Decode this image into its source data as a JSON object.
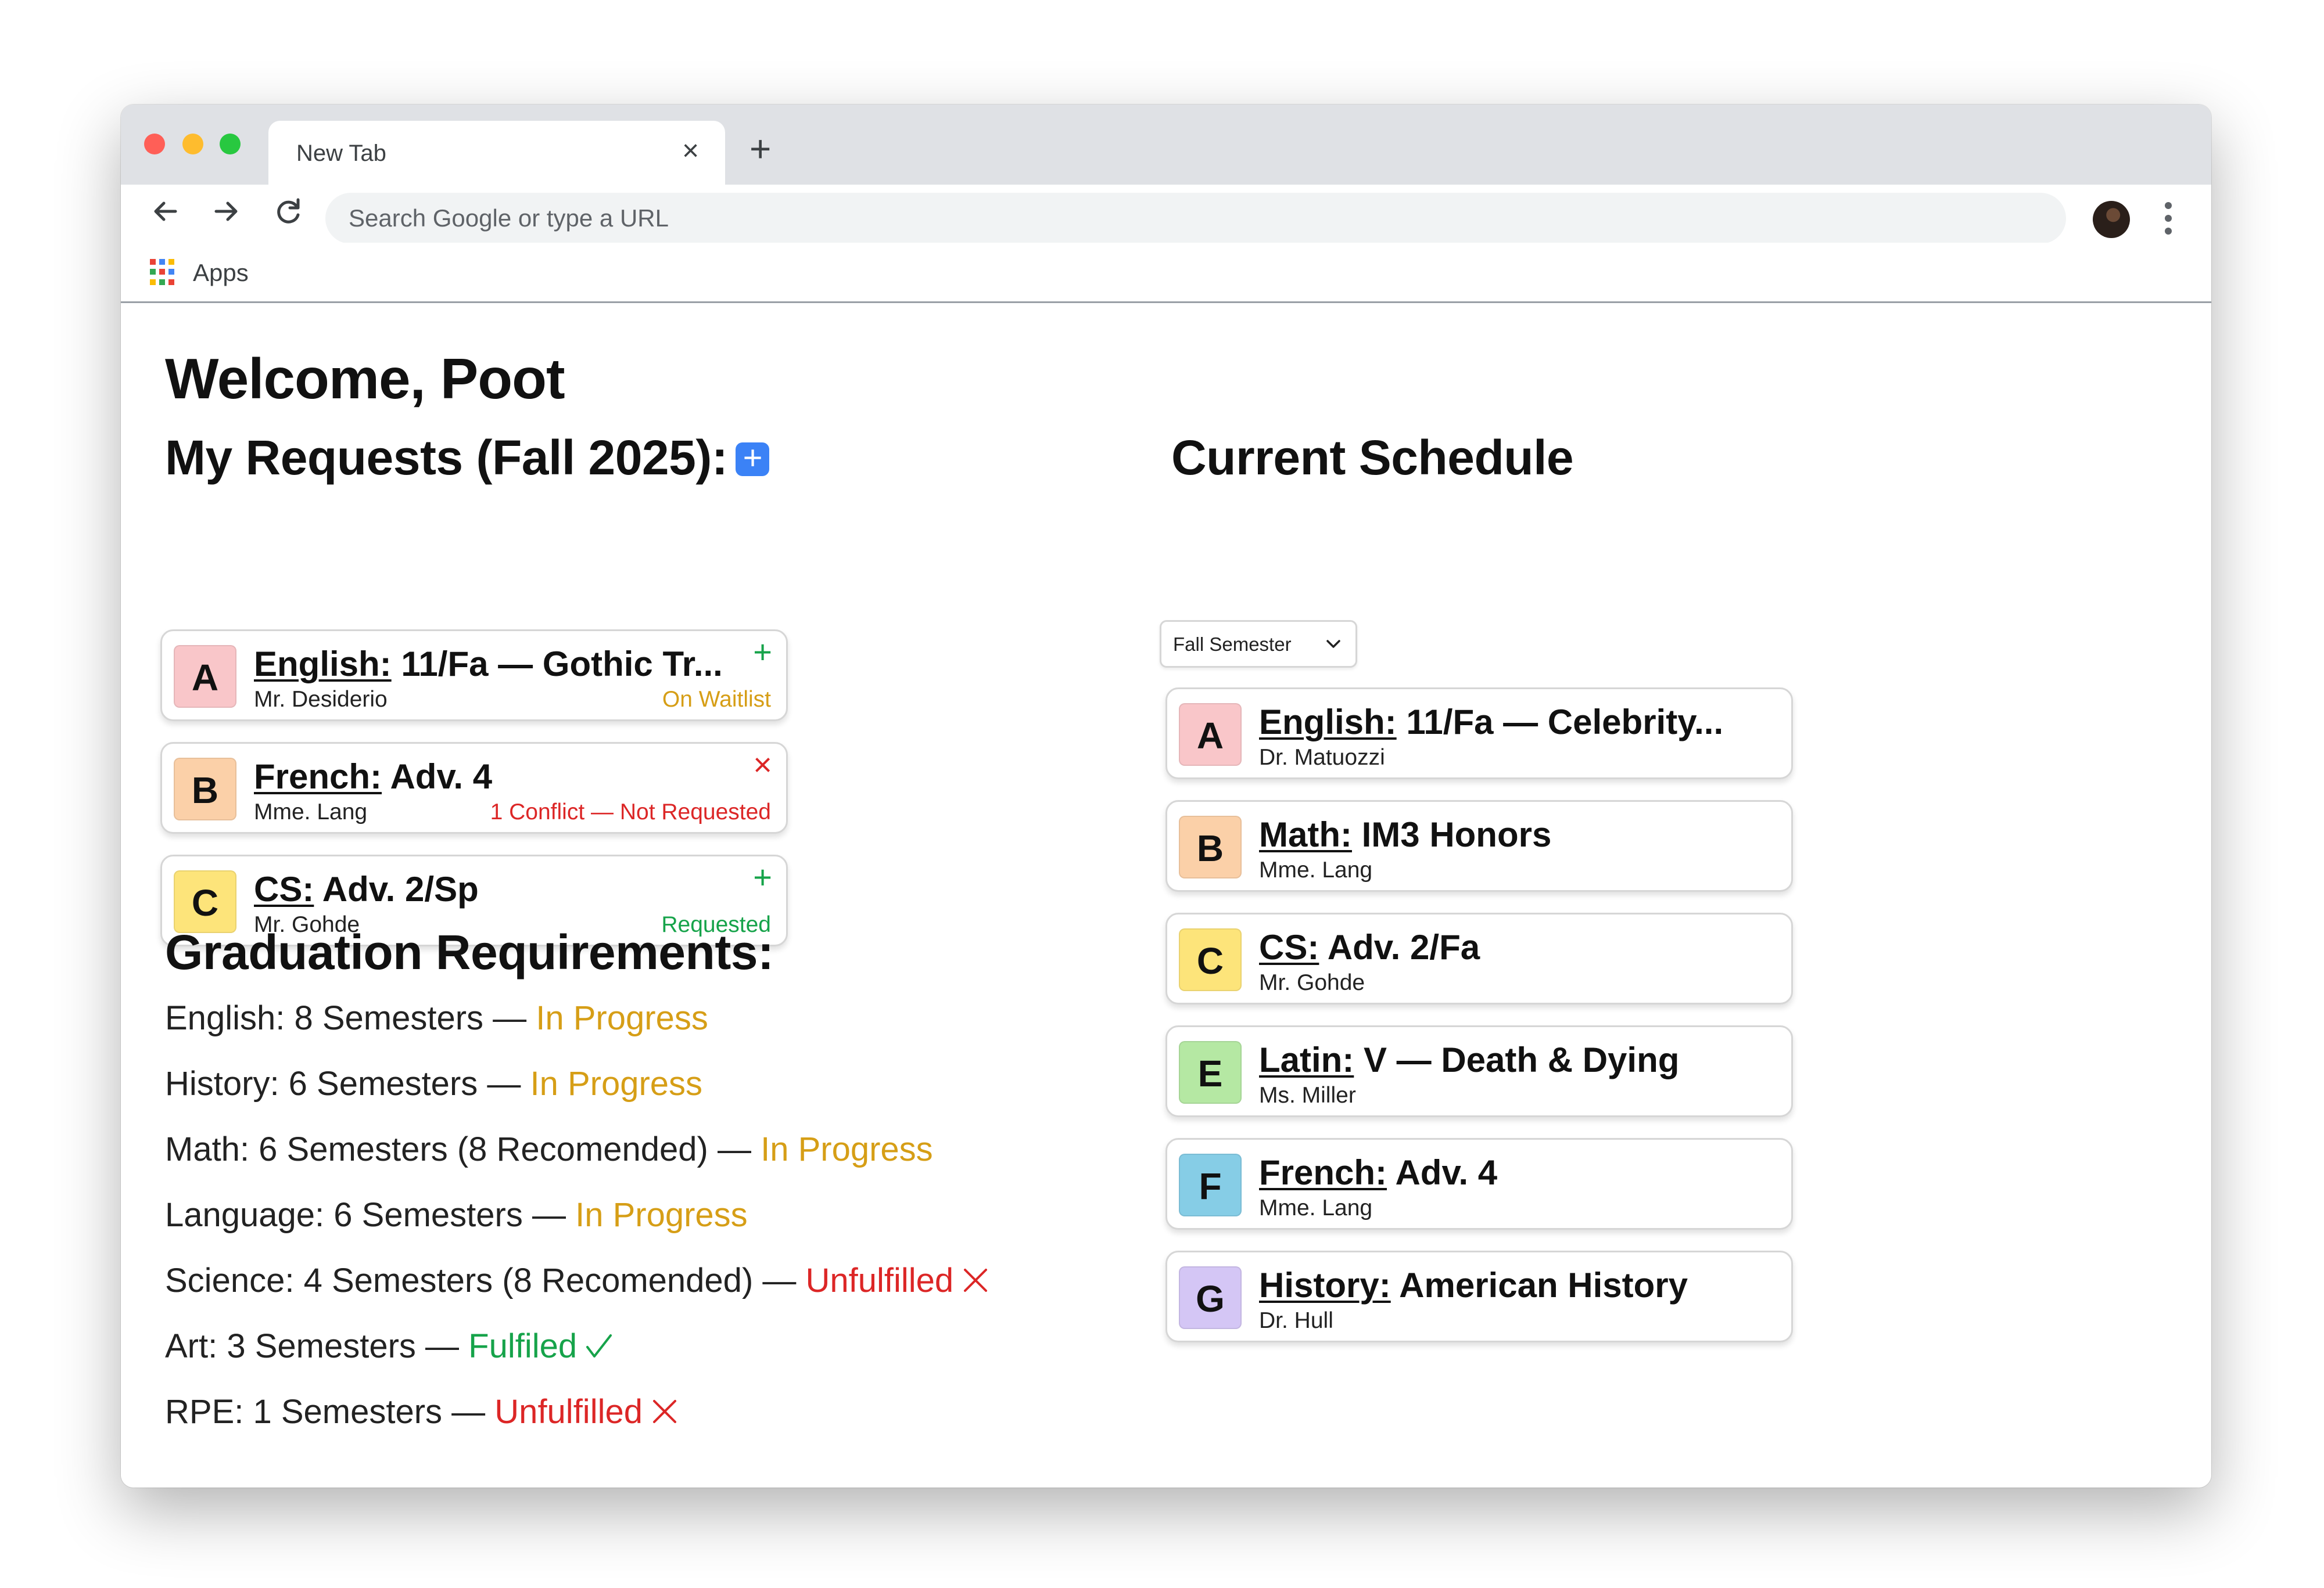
{
  "browser": {
    "tab_title": "New Tab",
    "tab_close": "×",
    "new_tab": "+",
    "omnibox_placeholder": "Search Google or type a URL",
    "bookmarks_apps_label": "Apps"
  },
  "page": {
    "welcome": "Welcome, Poot",
    "requests_title": "My Requests (Fall 2025):",
    "add_button": "+",
    "requests": [
      {
        "block": "A",
        "block_color": "#f9c6c9",
        "subject": "English:",
        "course": " 11/Fa — Gothic Tr...",
        "teacher": "Mr. Desiderio",
        "status": "On Waitlist",
        "status_color": "#d69e16",
        "corner": "+",
        "corner_color": "#16a34a"
      },
      {
        "block": "B",
        "block_color": "#fbd0a8",
        "subject": "French:",
        "course": " Adv. 4",
        "teacher": "Mme. Lang",
        "status": "1 Conflict — Not Requested",
        "status_color": "#dc2626",
        "corner": "×",
        "corner_color": "#dc2626"
      },
      {
        "block": "C",
        "block_color": "#fde47a",
        "subject": "CS:",
        "course": " Adv. 2/Sp",
        "teacher": "Mr. Gohde",
        "status": "Requested",
        "status_color": "#16a34a",
        "corner": "+",
        "corner_color": "#16a34a"
      }
    ],
    "grad_title": "Graduation Requirements:",
    "requirements": [
      {
        "text": "English: 8 Semesters — ",
        "status": "In Progress",
        "state": "progress"
      },
      {
        "text": "History: 6 Semesters — ",
        "status": "In Progress",
        "state": "progress"
      },
      {
        "text": "Math: 6 Semesters (8 Recomended) — ",
        "status": "In Progress",
        "state": "progress"
      },
      {
        "text": "Language: 6 Semesters — ",
        "status": "In Progress",
        "state": "progress"
      },
      {
        "text": "Science: 4 Semesters (8 Recomended) — ",
        "status": "Unfulfilled",
        "state": "unfulfilled"
      },
      {
        "text": "Art: 3 Semesters — ",
        "status": "Fulfiled",
        "state": "fulfilled"
      },
      {
        "text": "RPE: 1 Semesters — ",
        "status": "Unfulfilled",
        "state": "unfulfilled"
      }
    ],
    "schedule_title": "Current Schedule",
    "semester_select": "Fall Semester",
    "schedule": [
      {
        "block": "A",
        "block_color": "#f9c6c9",
        "subject": "English:",
        "course": " 11/Fa — Celebrity...",
        "teacher": "Dr. Matuozzi"
      },
      {
        "block": "B",
        "block_color": "#fbd0a8",
        "subject": "Math:",
        "course": " IM3 Honors",
        "teacher": "Mme. Lang"
      },
      {
        "block": "C",
        "block_color": "#fde47a",
        "subject": "CS:",
        "course": " Adv. 2/Fa",
        "teacher": "Mr. Gohde"
      },
      {
        "block": "E",
        "block_color": "#b5e8a3",
        "subject": "Latin:",
        "course": " V — Death & Dying",
        "teacher": "Ms. Miller"
      },
      {
        "block": "F",
        "block_color": "#86cde6",
        "subject": "French:",
        "course": " Adv. 4",
        "teacher": "Mme. Lang"
      },
      {
        "block": "G",
        "block_color": "#d4c6f5",
        "subject": "History:",
        "course": " American History",
        "teacher": "Dr. Hull"
      }
    ]
  }
}
